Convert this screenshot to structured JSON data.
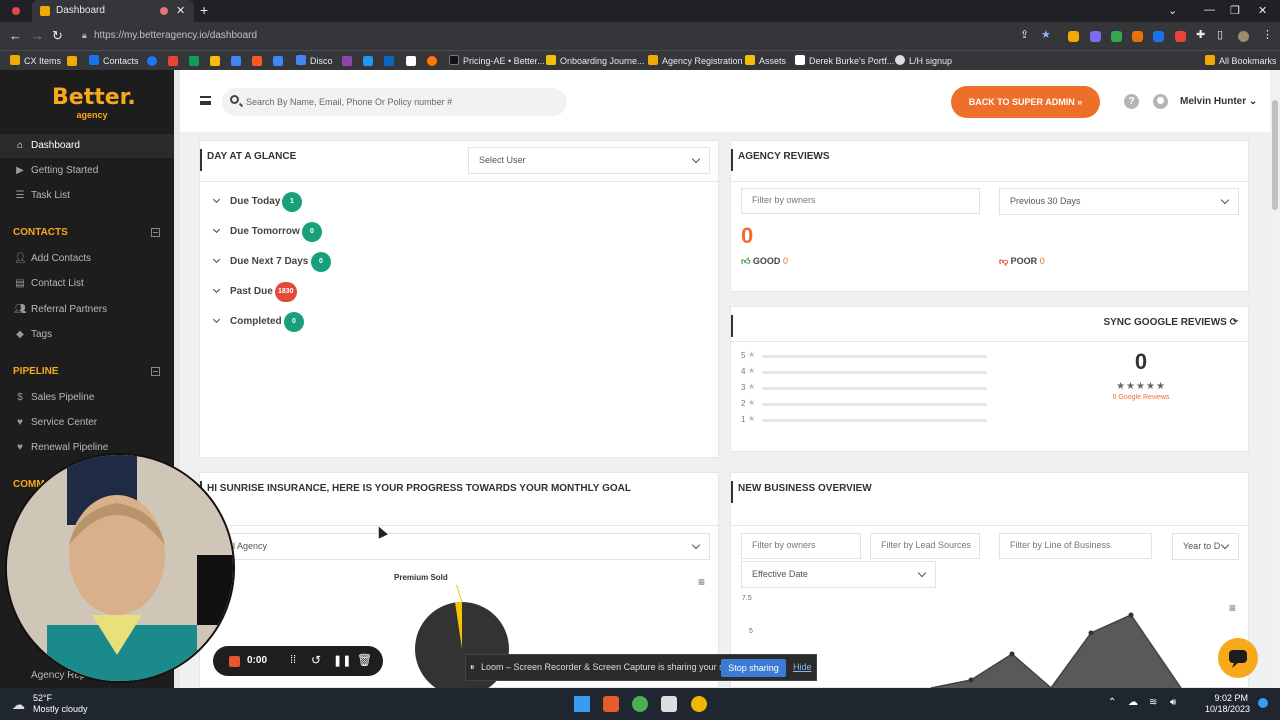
{
  "browser": {
    "tab_title": "Dashboard",
    "url": "https://my.betteragency.io/dashboard",
    "bookmarks": [
      "CX Items",
      "Contacts",
      "Disco",
      "Pricing-AE • Better...",
      "Onboarding Journe...",
      "Agency Registration",
      "Assets",
      "Derek Burke's Portf...",
      "L/H signup",
      "All Bookmarks"
    ]
  },
  "brand": {
    "name": "Better.",
    "sub": "agency",
    "color": "#f7a81b"
  },
  "sidebar": {
    "top_items": [
      {
        "label": "Dashboard",
        "icon": "home-icon"
      },
      {
        "label": "Getting Started",
        "icon": "play-icon"
      },
      {
        "label": "Task List",
        "icon": "list-icon"
      }
    ],
    "contacts_title": "CONTACTS",
    "contacts_items": [
      {
        "label": "Add Contacts",
        "icon": "user-plus-icon"
      },
      {
        "label": "Contact List",
        "icon": "contact-list-icon"
      },
      {
        "label": "Referral Partners",
        "icon": "users-icon"
      },
      {
        "label": "Tags",
        "icon": "tag-icon"
      }
    ],
    "pipeline_title": "PIPELINE",
    "pipeline_items": [
      {
        "label": "Sales Pipeline",
        "icon": "dollar-icon"
      },
      {
        "label": "Service Center",
        "icon": "heart-icon"
      },
      {
        "label": "Renewal Pipeline",
        "icon": "heart-icon"
      }
    ],
    "comm_title": "COMM",
    "bottom_item": "Agency Rep"
  },
  "header": {
    "search_placeholder": "Search By Name, Email, Phone Or Policy number #",
    "back_button": "BACK TO SUPER ADMIN",
    "user_name": "Melvin Hunter"
  },
  "day_glance": {
    "title": "DAY AT A GLANCE",
    "select_user": "Select User",
    "rows": [
      {
        "label": "Due Today",
        "count": "1",
        "color": "#17a07a"
      },
      {
        "label": "Due Tomorrow",
        "count": "0",
        "color": "#17a07a"
      },
      {
        "label": "Due Next 7 Days",
        "count": "0",
        "color": "#17a07a"
      },
      {
        "label": "Past Due",
        "count": "1830",
        "color": "#e24a3b"
      },
      {
        "label": "Completed",
        "count": "0",
        "color": "#17a07a"
      }
    ]
  },
  "agency_reviews": {
    "title": "AGENCY REVIEWS",
    "filter_placeholder": "Filter by owners",
    "period": "Previous 30 Days",
    "total": "0",
    "good_label": "GOOD",
    "good_count": "0",
    "poor_label": "POOR",
    "poor_count": "0"
  },
  "google_reviews": {
    "sync_label": "SYNC GOOGLE REVIEWS",
    "rating_rows": [
      "5",
      "4",
      "3",
      "2",
      "1"
    ],
    "total": "0",
    "link": "0 Google Reviews"
  },
  "goal": {
    "title": "HI SUNRISE INSURANCE, HERE IS YOUR PROGRESS TOWARDS YOUR MONTHLY GOAL",
    "select": "ll Agency",
    "chart_title": "Premium Sold"
  },
  "new_business": {
    "title": "NEW BUSINESS OVERVIEW",
    "filter_owners": "Filter by owners",
    "filter_sources": "Filter by Lead Sources",
    "filter_lob": "Filter by Line of Business",
    "period": "Year to D",
    "date_type": "Effective Date",
    "y_ticks": [
      "7.5",
      "5"
    ]
  },
  "recorder": {
    "time": "0:00"
  },
  "loom": {
    "message": "Loom – Screen Recorder & Screen Capture is sharing your screen.",
    "stop": "Stop sharing",
    "hide": "Hide"
  },
  "taskbar": {
    "temp": "52°F",
    "weather": "Mostly cloudy",
    "time": "9:02 PM",
    "date": "10/18/2023"
  }
}
